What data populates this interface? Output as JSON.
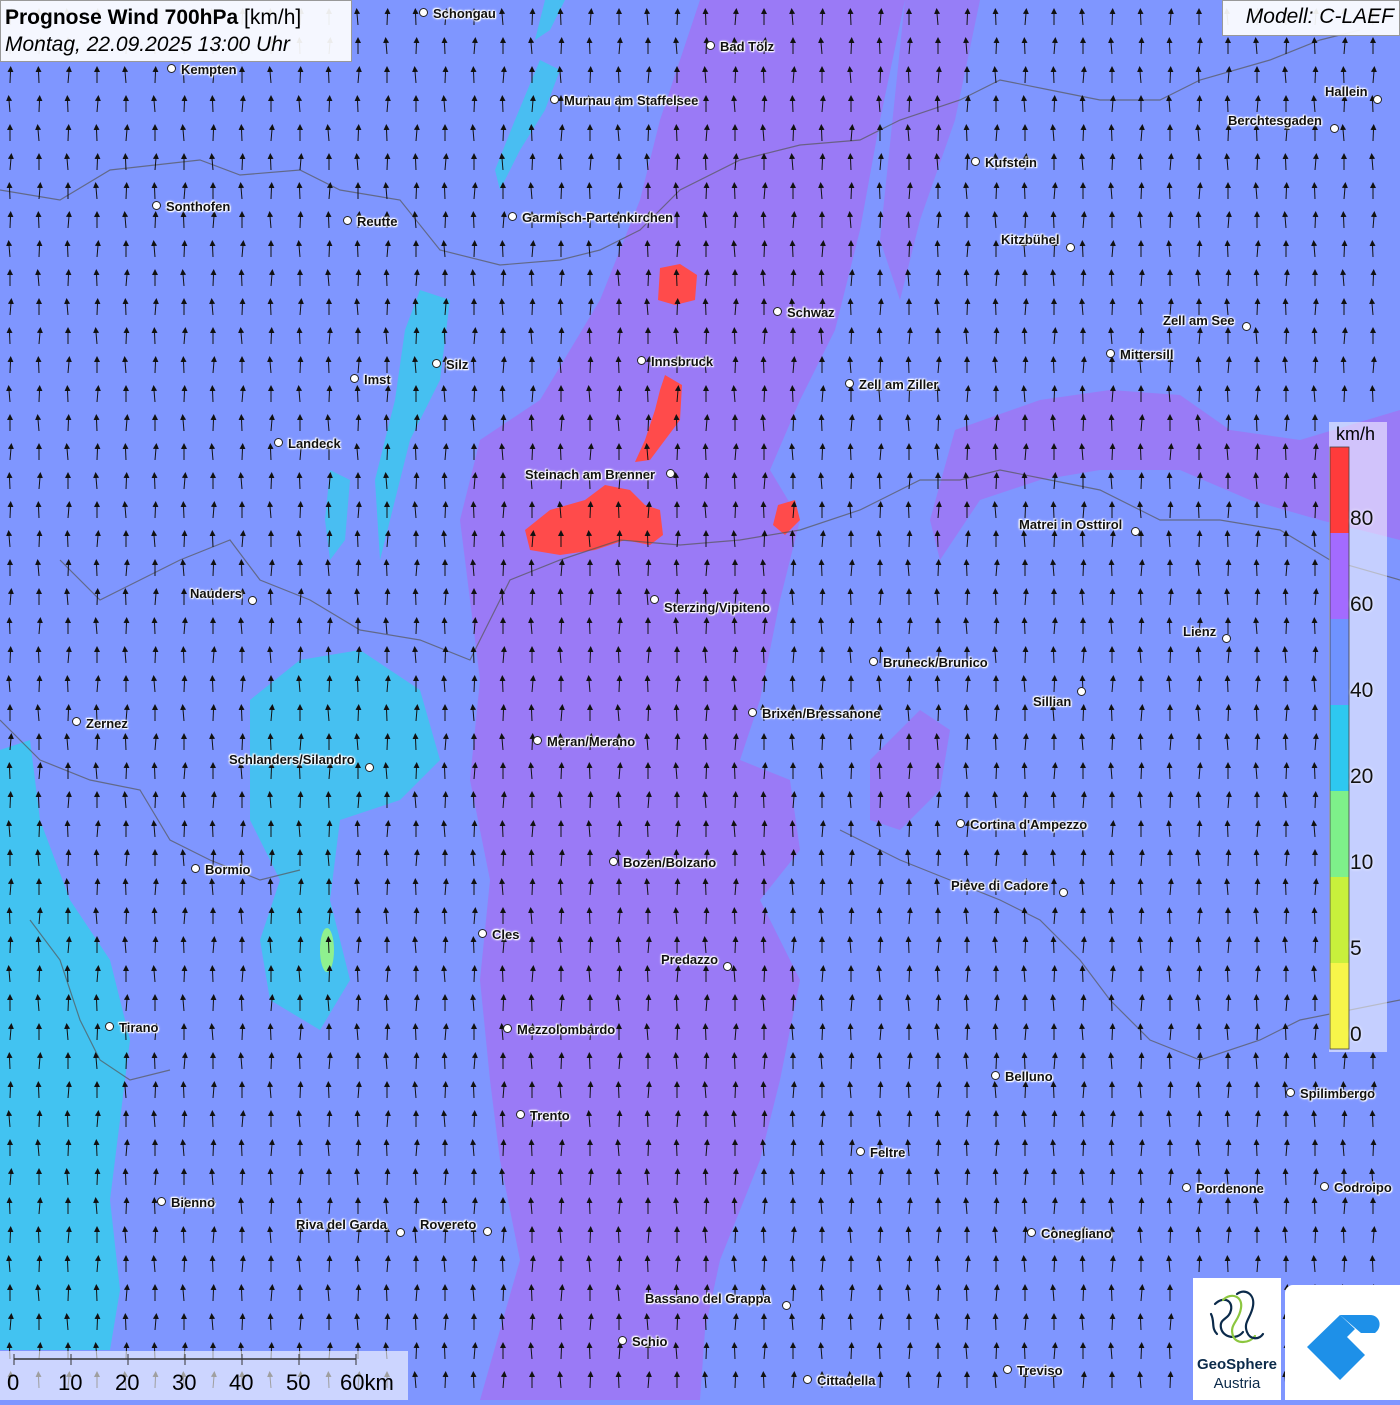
{
  "header": {
    "title_bold": "Prognose Wind 700hPa",
    "title_unit": "[km/h]",
    "datetime": "Montag, 22.09.2025 13:00 Uhr",
    "model": "Modell: C-LAEF"
  },
  "legend": {
    "unit": "km/h",
    "ticks": [
      "80",
      "60",
      "40",
      "20",
      "10",
      "5",
      "0"
    ],
    "colors": [
      "#ff3b3b",
      "#a36bff",
      "#6f93ff",
      "#2ec8f0",
      "#7ef08a",
      "#c8f03c",
      "#f7f54a"
    ]
  },
  "scale_bar": {
    "labels": [
      "0",
      "10",
      "20",
      "30",
      "40",
      "50",
      "60km"
    ]
  },
  "logo": {
    "name_line1": "GeoSphere",
    "name_line2": "Austria"
  },
  "places": [
    {
      "name": "Schongau"
    },
    {
      "name": "Bad Tölz"
    },
    {
      "name": "Kempten"
    },
    {
      "name": "Murnau am Staffelsee"
    },
    {
      "name": "Hallein"
    },
    {
      "name": "Berchtesgaden"
    },
    {
      "name": "Kufstein"
    },
    {
      "name": "Sonthofen"
    },
    {
      "name": "Reutte"
    },
    {
      "name": "Garmisch-Partenkirchen"
    },
    {
      "name": "Kitzbühel"
    },
    {
      "name": "Schwaz"
    },
    {
      "name": "Zell am See"
    },
    {
      "name": "Mittersill"
    },
    {
      "name": "Innsbruck"
    },
    {
      "name": "Imst"
    },
    {
      "name": "Silz"
    },
    {
      "name": "Zell am Ziller"
    },
    {
      "name": "Landeck"
    },
    {
      "name": "Steinach am Brenner"
    },
    {
      "name": "Matrei in Osttirol"
    },
    {
      "name": "Nauders"
    },
    {
      "name": "Sterzing/Vipiteno"
    },
    {
      "name": "Lienz"
    },
    {
      "name": "Bruneck/Brunico"
    },
    {
      "name": "Sillian"
    },
    {
      "name": "Zernez"
    },
    {
      "name": "Brixen/Bressanone"
    },
    {
      "name": "Meran/Merano"
    },
    {
      "name": "Schlanders/Silandro"
    },
    {
      "name": "Cortina d'Ampezzo"
    },
    {
      "name": "Bozen/Bolzano"
    },
    {
      "name": "Bormio"
    },
    {
      "name": "Pieve di Cadore"
    },
    {
      "name": "Cles"
    },
    {
      "name": "Predazzo"
    },
    {
      "name": "Tirano"
    },
    {
      "name": "Mezzolombardo"
    },
    {
      "name": "Belluno"
    },
    {
      "name": "Spilimbergo"
    },
    {
      "name": "Trento"
    },
    {
      "name": "Feltre"
    },
    {
      "name": "Pordenone"
    },
    {
      "name": "Codroipo"
    },
    {
      "name": "Bienno"
    },
    {
      "name": "Riva del Garda"
    },
    {
      "name": "Rovereto"
    },
    {
      "name": "Conegliano"
    },
    {
      "name": "Bassano del Grappa"
    },
    {
      "name": "Schio"
    },
    {
      "name": "Treviso"
    },
    {
      "name": "Cittadella"
    }
  ]
}
